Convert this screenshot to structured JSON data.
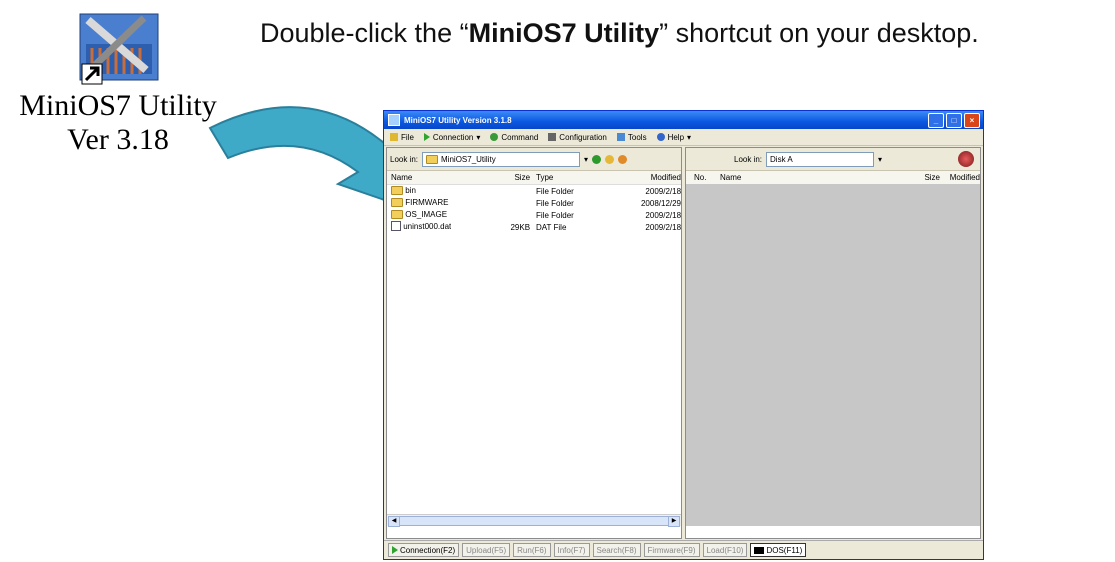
{
  "shortcut": {
    "caption_line1": "MiniOS7 Utility",
    "caption_line2": "Ver 3.18"
  },
  "instruction": {
    "before": "Double-click the “",
    "bold": "MiniOS7 Utility",
    "after": "” shortcut on your desktop."
  },
  "window": {
    "title": "MiniOS7 Utility Version 3.1.8",
    "menu": [
      "File",
      "Connection",
      "Command",
      "Configuration",
      "Tools",
      "Help"
    ],
    "left": {
      "look_in_label": "Look in:",
      "look_in_value": "MiniOS7_Utility",
      "headers": {
        "name": "Name",
        "size": "Size",
        "type": "Type",
        "modified": "Modified"
      },
      "files": [
        {
          "name": "bin",
          "size": "",
          "type": "File Folder",
          "modified": "2009/2/18"
        },
        {
          "name": "FIRMWARE",
          "size": "",
          "type": "File Folder",
          "modified": "2008/12/29"
        },
        {
          "name": "OS_IMAGE",
          "size": "",
          "type": "File Folder",
          "modified": "2009/2/18"
        },
        {
          "name": "uninst000.dat",
          "size": "29KB",
          "type": "DAT File",
          "modified": "2009/2/18"
        }
      ]
    },
    "right": {
      "look_in_label": "Look in:",
      "look_in_value": "Disk A",
      "headers": {
        "no": "No.",
        "name": "Name",
        "size": "Size",
        "modified": "Modified"
      }
    },
    "status_buttons": [
      "Connection(F2)",
      "Upload(F5)",
      "Run(F6)",
      "Info(F7)",
      "Search(F8)",
      "Firmware(F9)",
      "Load(F10)",
      "DOS(F11)"
    ]
  },
  "colors": {
    "titlebar": "#0a58e0",
    "arrow": "#3fa9c8"
  }
}
